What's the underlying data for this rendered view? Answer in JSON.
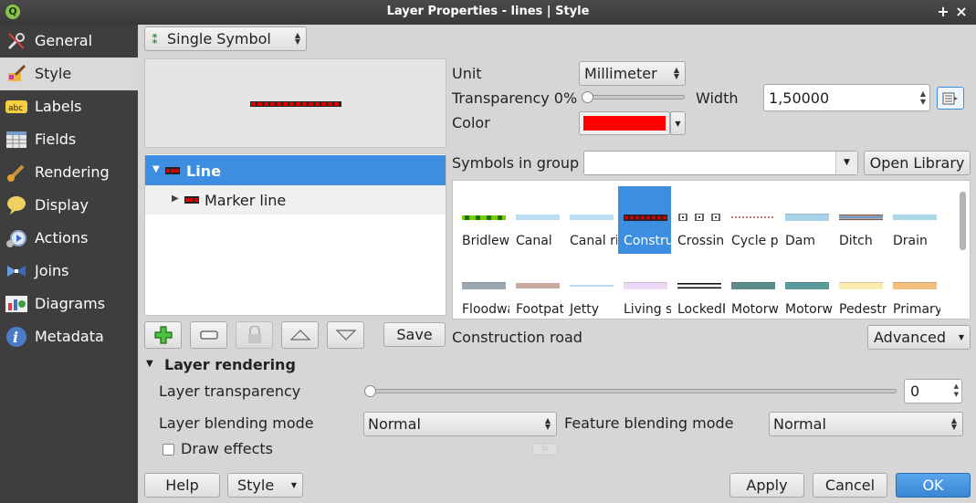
{
  "window": {
    "title": "Layer Properties - lines | Style",
    "controls": [
      "+",
      "×"
    ]
  },
  "sidebar": {
    "items": [
      {
        "label": "General",
        "icon": "wrench-icon"
      },
      {
        "label": "Style",
        "icon": "paintbrush-icon",
        "active": true
      },
      {
        "label": "Labels",
        "icon": "abc-label-icon"
      },
      {
        "label": "Fields",
        "icon": "table-icon"
      },
      {
        "label": "Rendering",
        "icon": "brush-icon"
      },
      {
        "label": "Display",
        "icon": "speech-bubble-icon"
      },
      {
        "label": "Actions",
        "icon": "gear-play-icon"
      },
      {
        "label": "Joins",
        "icon": "join-icon"
      },
      {
        "label": "Diagrams",
        "icon": "chart-icon"
      },
      {
        "label": "Metadata",
        "icon": "info-icon"
      }
    ]
  },
  "renderer": {
    "type": "Single Symbol"
  },
  "symbol_tree": {
    "root": "Line",
    "child": "Marker line"
  },
  "layer_buttons": {
    "save": "Save"
  },
  "properties": {
    "unit_label": "Unit",
    "unit_value": "Millimeter",
    "transparency_label": "Transparency 0%",
    "transparency_value": 0,
    "width_label": "Width",
    "width_value": "1,50000",
    "color_label": "Color",
    "color_value": "#ff0000"
  },
  "library": {
    "group_label": "Symbols in group",
    "group_value": "",
    "open_library": "Open Library",
    "symbols_row1": [
      {
        "name": "Bridleway",
        "color": "#6fcf00",
        "style": "dashed"
      },
      {
        "name": "Canal",
        "color": "#bcdcf4",
        "style": "solid"
      },
      {
        "name": "Canal river",
        "color": "#bcdcf4",
        "style": "solid"
      },
      {
        "name": "Construction road",
        "color": "#cc0000",
        "style": "beaded",
        "selected": true
      },
      {
        "name": "Crossing",
        "color": "#333333",
        "style": "boxes"
      },
      {
        "name": "Cycle path",
        "color": "#c44",
        "style": "dotted"
      },
      {
        "name": "Dam",
        "color": "#a9d2e8",
        "style": "thick"
      },
      {
        "name": "Ditch",
        "color": "#7a5a4a",
        "style": "double"
      },
      {
        "name": "Drain",
        "color": "#a9d8e6",
        "style": "solid"
      }
    ],
    "symbols_row2": [
      {
        "name": "Floodwall",
        "color": "#9aa8b4",
        "style": "thick"
      },
      {
        "name": "Footpath",
        "color": "#c8aaa0",
        "style": "solid"
      },
      {
        "name": "Jetty",
        "color": "#bcdcf4",
        "style": "thin"
      },
      {
        "name": "Living street",
        "color": "#ecd8f4",
        "style": "thick"
      },
      {
        "name": "LockedRoad",
        "color": "#111111",
        "style": "double"
      },
      {
        "name": "Motorway",
        "color": "#5a8c8c",
        "style": "thick"
      },
      {
        "name": "Motorway link",
        "color": "#5a9c9c",
        "style": "thick"
      },
      {
        "name": "Pedestrian",
        "color": "#f8ecb0",
        "style": "thick"
      },
      {
        "name": "Primary",
        "color": "#f4c080",
        "style": "thick"
      }
    ],
    "selected_name": "Construction road",
    "advanced": "Advanced"
  },
  "layer_rendering": {
    "header": "Layer rendering",
    "transparency_label": "Layer transparency",
    "transparency_value": "0",
    "blending_label": "Layer blending mode",
    "blending_value": "Normal",
    "feature_blending_label": "Feature blending mode",
    "feature_blending_value": "Normal",
    "draw_effects_label": "Draw effects"
  },
  "footer": {
    "help": "Help",
    "style": "Style",
    "apply": "Apply",
    "cancel": "Cancel",
    "ok": "OK"
  }
}
